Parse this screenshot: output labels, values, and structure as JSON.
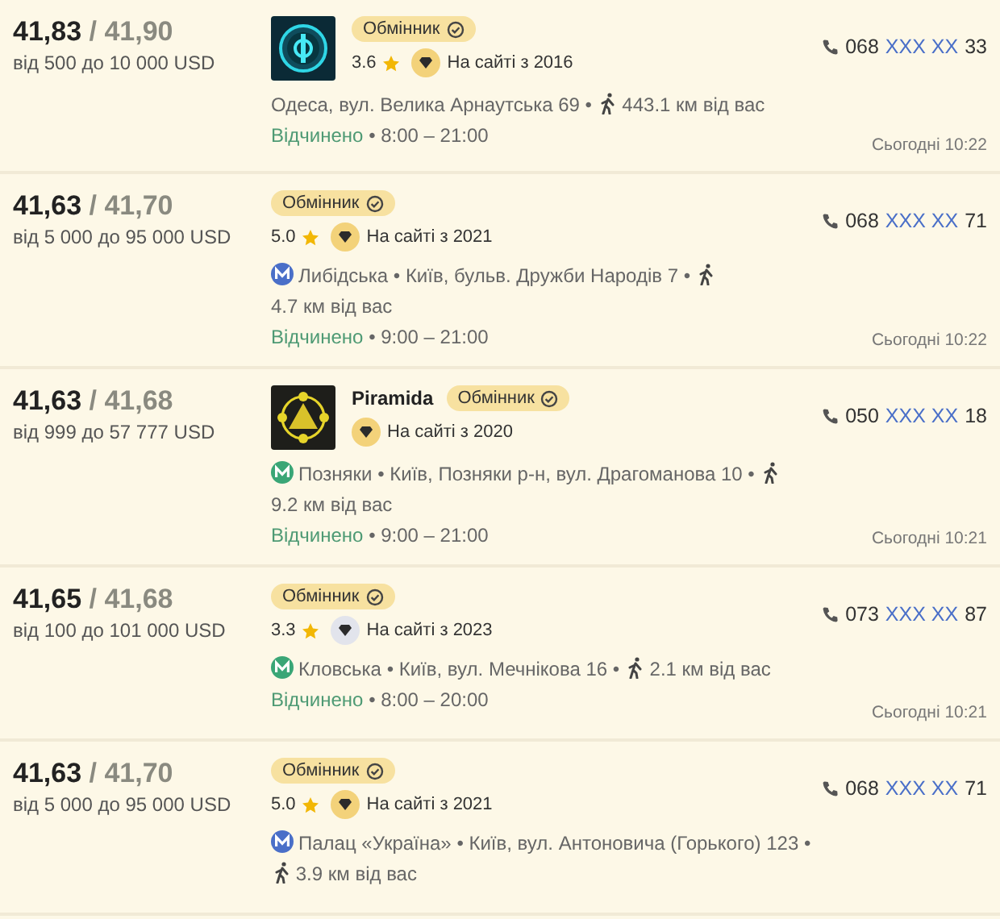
{
  "offers": [
    {
      "buy": "41,83",
      "sell": "/ 41,90",
      "range": "від 500 до 10 000 USD",
      "badge": "Обмінник",
      "rating": "3.6",
      "since": {
        "text": "На сайті з 2016",
        "color": "#f3d27a"
      },
      "address": "Одеса, вул. Велика Арнаутська 69 •",
      "distance": "443.1 км від вас",
      "status": "Відчинено",
      "hours": "• 8:00 – 21:00",
      "phone": [
        "068",
        "XXX XX",
        "33"
      ],
      "updated": "Сьогодні 10:22"
    },
    {
      "buy": "41,63",
      "sell": "/ 41,70",
      "range": "від 5 000 до 95 000 USD",
      "badge": "Обмінник",
      "rating": "5.0",
      "since": {
        "text": "На сайті з 2021",
        "color": "#f3d27a"
      },
      "station": {
        "name": "Либідська",
        "color": "#4a6fc8"
      },
      "address": "• Київ, бульв. Дружби Народів 7 •",
      "distance": "4.7 км від вас",
      "status": "Відчинено",
      "hours": "• 9:00 – 21:00",
      "phone": [
        "068",
        "XXX XX",
        "71"
      ],
      "updated": "Сьогодні 10:22"
    },
    {
      "buy": "41,63",
      "sell": "/ 41,68",
      "range": "від 999 до 57 777 USD",
      "name": "Piramida",
      "badge": "Обмінник",
      "since": {
        "text": "На сайті з 2020",
        "color": "#f3d27a"
      },
      "station": {
        "name": "Позняки",
        "color": "#3aa676"
      },
      "address": "• Київ, Позняки р-н, вул. Драгоманова 10 •",
      "distance": "9.2 км від вас",
      "status": "Відчинено",
      "hours": "• 9:00 – 21:00",
      "phone": [
        "050",
        "XXX XX",
        "18"
      ],
      "updated": "Сьогодні 10:21"
    },
    {
      "buy": "41,65",
      "sell": "/ 41,68",
      "range": "від 100 до 101 000 USD",
      "badge": "Обмінник",
      "rating": "3.3",
      "since": {
        "text": "На сайті з 2023",
        "color": "#e2e4ec"
      },
      "station": {
        "name": "Кловська",
        "color": "#3aa676"
      },
      "address": "• Київ, вул. Мечнікова 16 •",
      "distance": "2.1 км від вас",
      "status": "Відчинено",
      "hours": "• 8:00 – 20:00",
      "phone": [
        "073",
        "XXX XX",
        "87"
      ],
      "updated": "Сьогодні 10:21"
    },
    {
      "buy": "41,63",
      "sell": "/ 41,70",
      "range": "від 5 000 до 95 000 USD",
      "badge": "Обмінник",
      "rating": "5.0",
      "since": {
        "text": "На сайті з 2021",
        "color": "#f3d27a"
      },
      "station": {
        "name": "Палац «Україна»",
        "color": "#4a6fc8"
      },
      "address": "• Київ, вул. Антоновича (Горького) 123 •",
      "distance": "3.9 км від вас",
      "phone": [
        "068",
        "XXX XX",
        "71"
      ]
    }
  ]
}
